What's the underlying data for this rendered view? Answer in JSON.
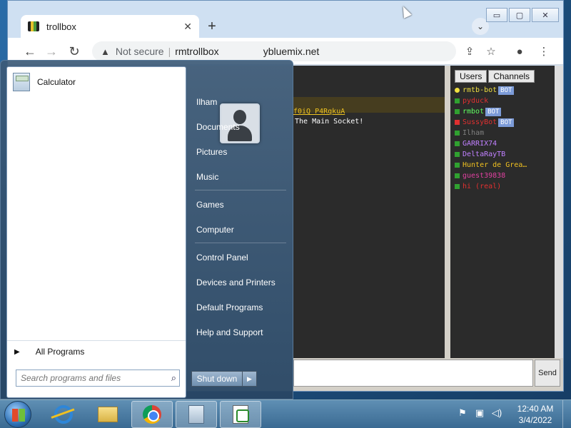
{
  "browser": {
    "tab_title": "trollbox",
    "tab_close_icon": "close-icon",
    "new_tab_icon": "plus-icon",
    "tab_search_icon": "chevron-down-icon",
    "window_controls": {
      "minimize": "▭",
      "maximize": "▢",
      "close": "✕"
    },
    "nav": {
      "back": "←",
      "forward": "→",
      "reload": "↻"
    },
    "address": {
      "security_label": "Not secure",
      "host": "rmtrollbox",
      "domain_tail": "ybluemix.net"
    },
    "toolbar_icons": {
      "share": "⇪",
      "bookmark": "☆",
      "profile": "●",
      "menu": "⋮"
    }
  },
  "chat": {
    "line1": "f0iQ P4RqkuA",
    "line2": "The Main Socket!"
  },
  "users_panel": {
    "tabs": [
      "Users",
      "Channels"
    ],
    "users": [
      {
        "name": "rmtb-bot",
        "color": "#f0e040",
        "dot": "#f0e040",
        "bot": "BOT"
      },
      {
        "name": "pyduck",
        "color": "#e03030",
        "dot": "#30a030",
        "bot": ""
      },
      {
        "name": "rmbot",
        "color": "#60ff60",
        "dot": "#30a030",
        "bot": "BOT"
      },
      {
        "name": "SussyBot",
        "color": "#e03030",
        "dot": "#e03030",
        "bot": "BOT"
      },
      {
        "name": "Ilham",
        "color": "#808080",
        "dot": "#30a030",
        "bot": ""
      },
      {
        "name": "GARRIX74",
        "color": "#c080ff",
        "dot": "#30a030",
        "bot": ""
      },
      {
        "name": "DeltaRayTB",
        "color": "#c080ff",
        "dot": "#30a030",
        "bot": ""
      },
      {
        "name": "Hunter de Grea…",
        "color": "#f0c020",
        "dot": "#30a030",
        "bot": ""
      },
      {
        "name": "guest39838",
        "color": "#e040a0",
        "dot": "#30a030",
        "bot": ""
      },
      {
        "name": "hi (real)",
        "color": "#e03030",
        "dot": "#30a030",
        "bot": ""
      }
    ],
    "send_label": "Send"
  },
  "start_menu": {
    "pinned": [
      {
        "label": "Calculator",
        "icon": "calculator-icon"
      }
    ],
    "all_programs": "All Programs",
    "search_placeholder": "Search programs and files",
    "user_name": "Ilham",
    "right_items": [
      "Documents",
      "Pictures",
      "Music",
      "Games",
      "Computer",
      "Control Panel",
      "Devices and Printers",
      "Default Programs",
      "Help and Support"
    ],
    "shutdown_label": "Shut down"
  },
  "taskbar": {
    "apps": [
      "internet-explorer-icon",
      "file-explorer-icon",
      "chrome-icon",
      "calculator-icon",
      "notepad-icon"
    ],
    "clock_time": "12:40 AM",
    "clock_date": "3/4/2022"
  }
}
